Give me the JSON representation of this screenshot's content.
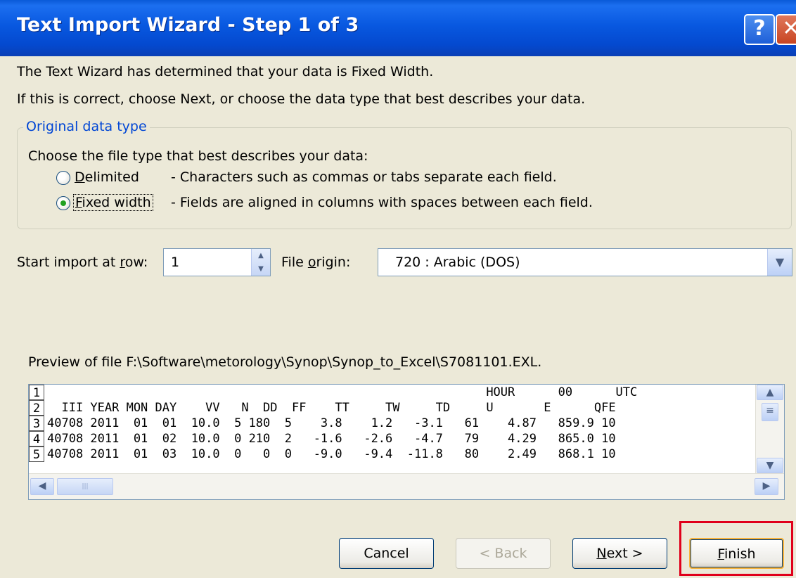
{
  "window": {
    "title": "Text Import Wizard - Step 1 of 3",
    "help_glyph": "?",
    "close_glyph": "✕"
  },
  "intro": {
    "line1": "The Text Wizard has determined that your data is Fixed Width.",
    "line2": "If this is correct, choose Next, or choose the data type that best describes your data."
  },
  "original_data_type": {
    "legend": "Original data type",
    "prompt": "Choose the file type that best describes your data:",
    "options": [
      {
        "label": "Delimited",
        "description": "- Characters such as commas or tabs separate each field.",
        "selected": false
      },
      {
        "label": "Fixed width",
        "description": "- Fields are aligned in columns with spaces between each field.",
        "selected": true
      }
    ]
  },
  "start_row": {
    "label": "Start import at row:",
    "value": "1"
  },
  "file_origin": {
    "label": "File origin:",
    "value": "720 : Arabic (DOS)"
  },
  "preview": {
    "caption": "Preview of file F:\\Software\\metorology\\Synop\\Synop_to_Excel\\S7081101.EXL.",
    "row_numbers": [
      "1",
      "2",
      "3",
      "4",
      "5"
    ],
    "lines": [
      "                                                             HOUR      00      UTC",
      "  III YEAR MON DAY    VV   N  DD  FF    TT     TW     TD     U       E      QFE",
      "40708 2011  01  01  10.0  5 180  5    3.8    1.2   -3.1   61    4.87   859.9 10",
      "40708 2011  01  02  10.0  0 210  2   -1.6   -2.6   -4.7   79    4.29   865.0 10",
      "40708 2011  01  03  10.0  0   0  0   -9.0   -9.4  -11.8   80    2.49   868.1 10"
    ]
  },
  "buttons": {
    "cancel": "Cancel",
    "back": "< Back",
    "next": "Next >",
    "finish": "Finish"
  }
}
